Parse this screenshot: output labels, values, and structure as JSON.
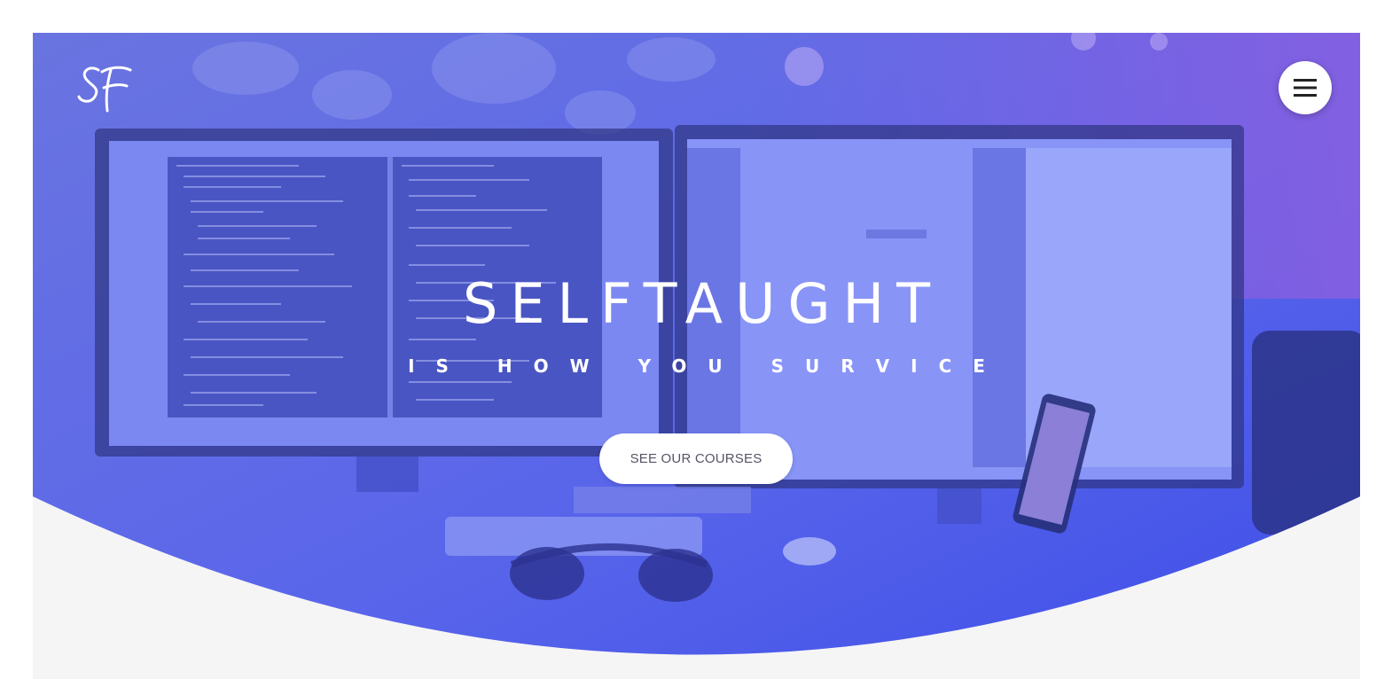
{
  "brand": {
    "logo_icon": "sf-monogram-logo",
    "accent_top_right": "#8a5fe0",
    "accent_bottom": "#3f4fe6",
    "hero_base": "#5a6ae8",
    "page_background": "#f5f5f5"
  },
  "header": {
    "menu_icon": "hamburger-menu-icon"
  },
  "hero": {
    "title": "SELFTAUGHT",
    "subtitle": "IS HOW YOU SURVICE",
    "cta_label": "SEE OUR COURSES"
  }
}
